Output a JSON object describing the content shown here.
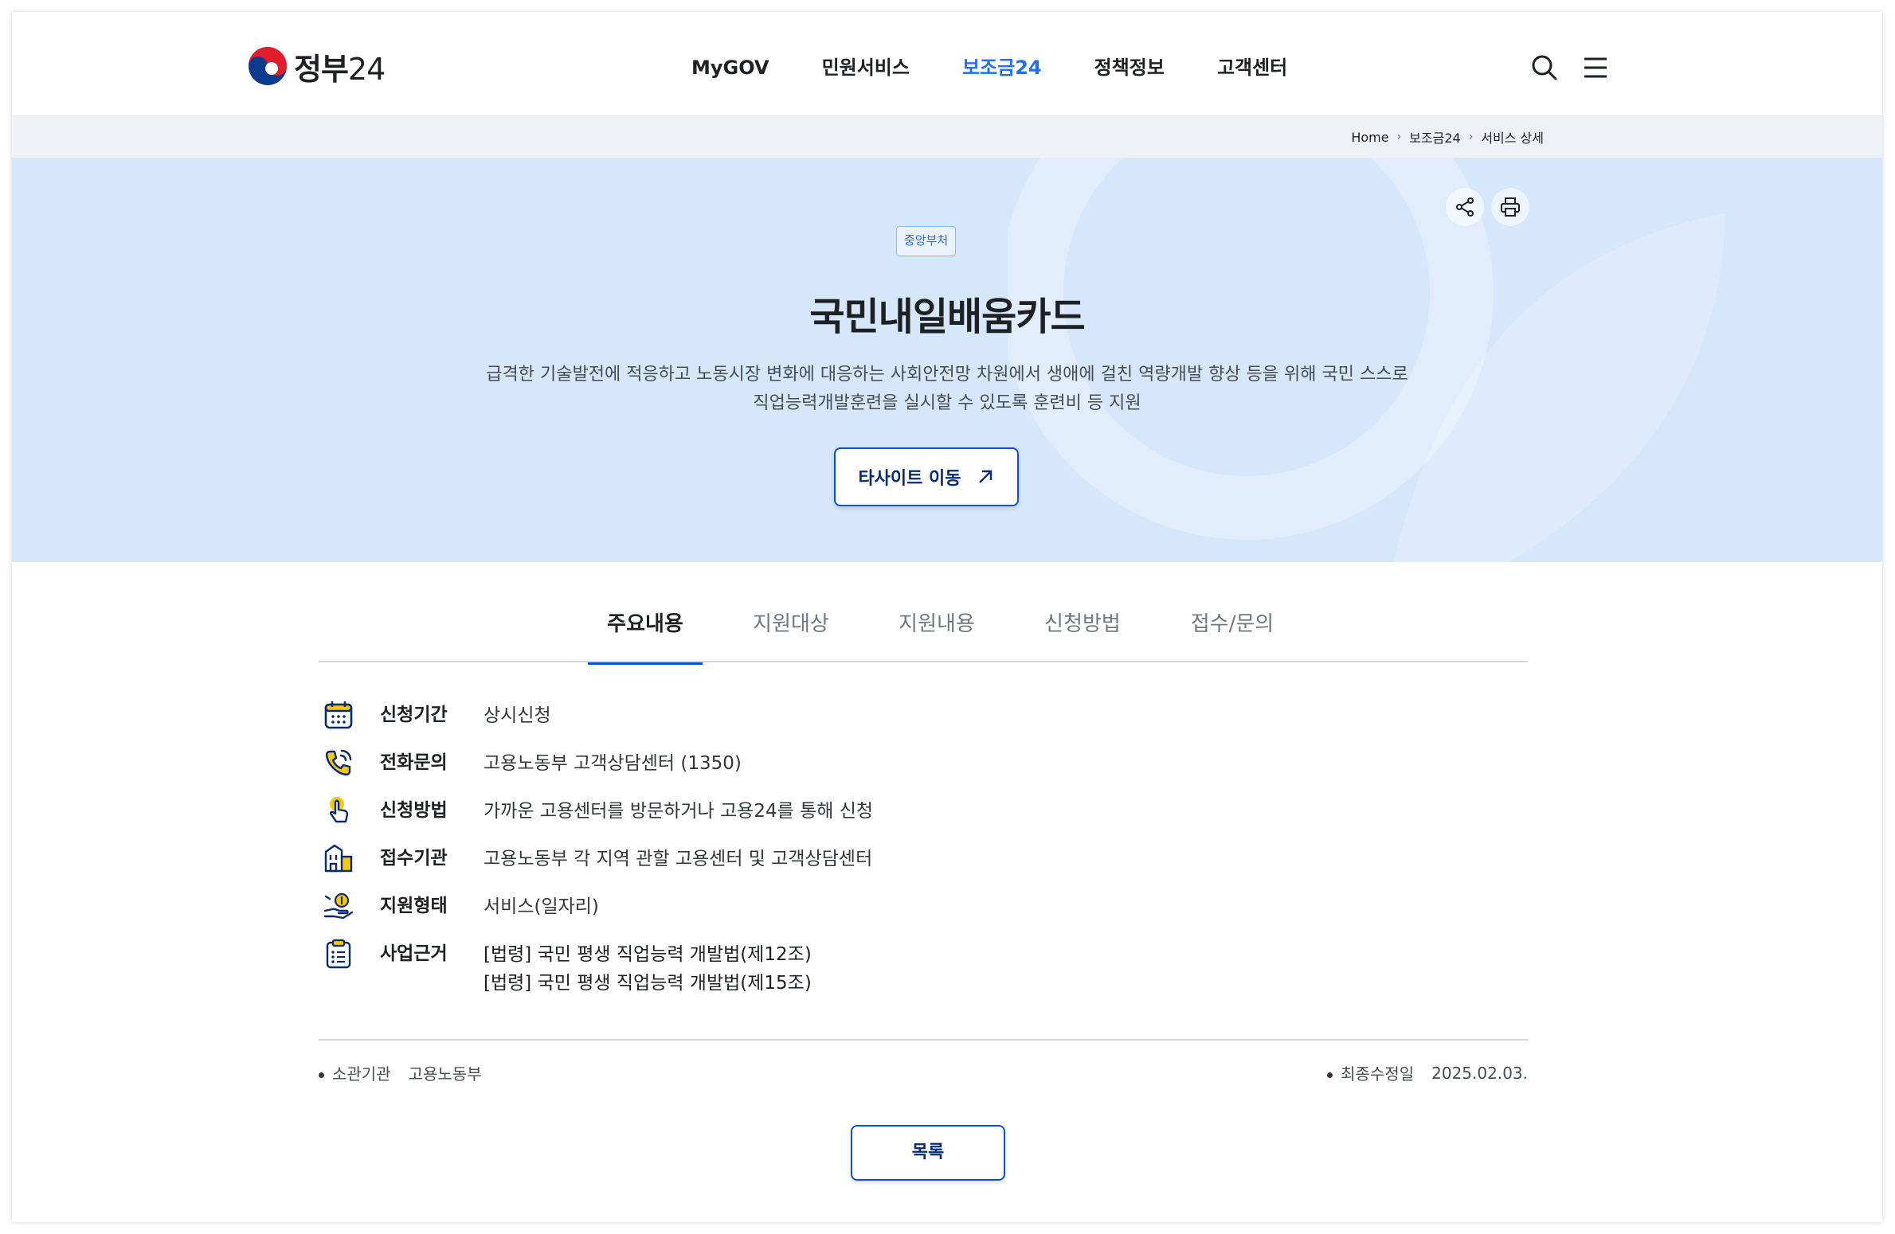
{
  "header": {
    "logo_text": "정부",
    "logo_num": "24",
    "nav": [
      {
        "label": "MyGOV"
      },
      {
        "label": "민원서비스"
      },
      {
        "label": "보조금24"
      },
      {
        "label": "정책정보"
      },
      {
        "label": "고객센터"
      }
    ],
    "active_nav": "보조금24"
  },
  "breadcrumb": [
    "Home",
    "보조금24",
    "서비스 상세"
  ],
  "hero": {
    "badge": "중앙부처",
    "title": "국민내일배움카드",
    "desc_line1": "급격한 기술발전에 적응하고 노동시장 변화에 대응하는 사회안전망 차원에서 생애에 걸친 역량개발 향상 등을 위해 국민 스스로",
    "desc_line2": "직업능력개발훈련을 실시할 수 있도록 훈련비 등 지원",
    "button_label": "타사이트 이동"
  },
  "tabs": [
    {
      "label": "주요내용"
    },
    {
      "label": "지원대상"
    },
    {
      "label": "지원내용"
    },
    {
      "label": "신청방법"
    },
    {
      "label": "접수/문의"
    }
  ],
  "active_tab": "주요내용",
  "info": [
    {
      "icon": "calendar-icon",
      "label": "신청기간",
      "value": "상시신청"
    },
    {
      "icon": "phone-icon",
      "label": "전화문의",
      "value": "고용노동부 고객상담센터 (1350)"
    },
    {
      "icon": "hand-pointer-icon",
      "label": "신청방법",
      "value": "가까운 고용센터를 방문하거나 고용24를 통해 신청"
    },
    {
      "icon": "building-icon",
      "label": "접수기관",
      "value": "고용노동부 각 지역 관할 고용센터 및 고객상담센터"
    },
    {
      "icon": "support-hand-icon",
      "label": "지원형태",
      "value": "서비스(일자리)"
    },
    {
      "icon": "clipboard-icon",
      "label": "사업근거",
      "value1": "[법령] 국민 평생 직업능력 개발법(제12조)",
      "value2": "[법령] 국민 평생 직업능력 개발법(제15조)"
    }
  ],
  "meta": {
    "agency_label": "소관기관",
    "agency_value": "고용노동부",
    "updated_label": "최종수정일",
    "updated_value": "2025.02.03."
  },
  "list_button": "목록",
  "colors": {
    "accent": "#256ef4",
    "button_border": "#0b50d0",
    "hero_bg": "#d6e6fb",
    "icon_navy": "#0b2a6b",
    "icon_yellow": "#f6c90e"
  }
}
